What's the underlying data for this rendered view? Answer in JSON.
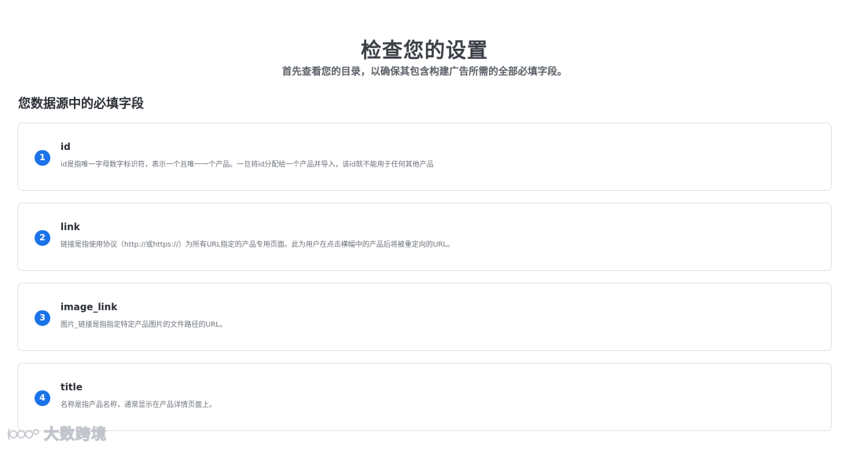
{
  "header": {
    "title": "检查您的设置",
    "subtitle": "首先查看您的目录，以确保其包含构建广告所需的全部必填字段。"
  },
  "section": {
    "title": "您数据源中的必填字段"
  },
  "fields": [
    {
      "number": "1",
      "name": "id",
      "description": "id是指唯一字母数字标识符，表示一个且唯一一个产品。一旦将id分配给一个产品并导入，该id就不能用于任何其他产品"
    },
    {
      "number": "2",
      "name": "link",
      "description": "链接是指使用协议（http://或https://）为所有URL指定的产品专用页面。此为用户在点击横幅中的产品后将被重定向的URL。"
    },
    {
      "number": "3",
      "name": "image_link",
      "description": "图片_链接是指指定特定产品图片的文件路径的URL。"
    },
    {
      "number": "4",
      "name": "title",
      "description": "名称是指产品名称，通常显示在产品详情页面上。"
    }
  ],
  "watermark": {
    "text": "大数跨境"
  },
  "colors": {
    "accent": "#1a73e8",
    "card_border": "#e1e3e6",
    "title_text": "#3b3f46"
  }
}
